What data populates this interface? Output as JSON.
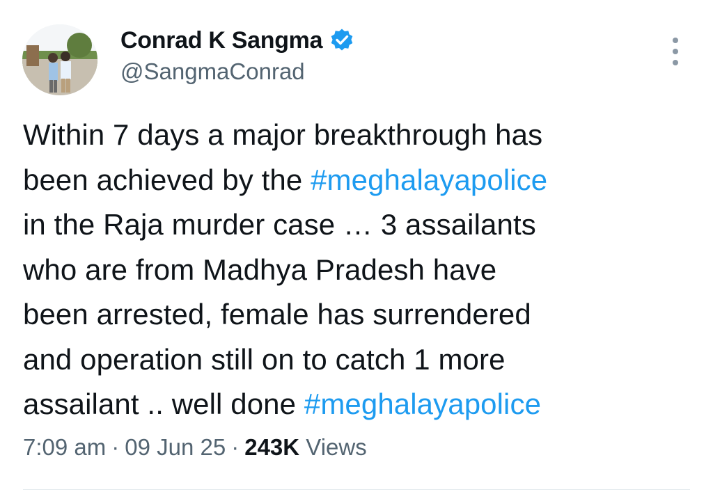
{
  "author": {
    "display_name": "Conrad K Sangma",
    "handle": "@SangmaConrad",
    "verified": true
  },
  "tweet": {
    "text_parts": [
      "Within 7 days a major breakthrough has\nbeen achieved by the ",
      "#meghalayapolice",
      "\nin the Raja murder case … 3 assailants\nwho are from Madhya Pradesh have\nbeen arrested, female  has surrendered\nand operation still on to catch 1 more\nassailant .. well done ",
      "#meghalayapolice"
    ]
  },
  "meta": {
    "time": "7:09 am",
    "sep1": "·",
    "date": "09 Jun 25",
    "sep2": "·",
    "views_count": "243K",
    "views_label": "Views"
  },
  "colors": {
    "link": "#1d9bf0",
    "text": "#0f1419",
    "secondary": "#536471",
    "verified": "#1d9bf0"
  },
  "icons": {
    "verified": "verified-badge-icon",
    "more": "more-vertical-icon"
  }
}
